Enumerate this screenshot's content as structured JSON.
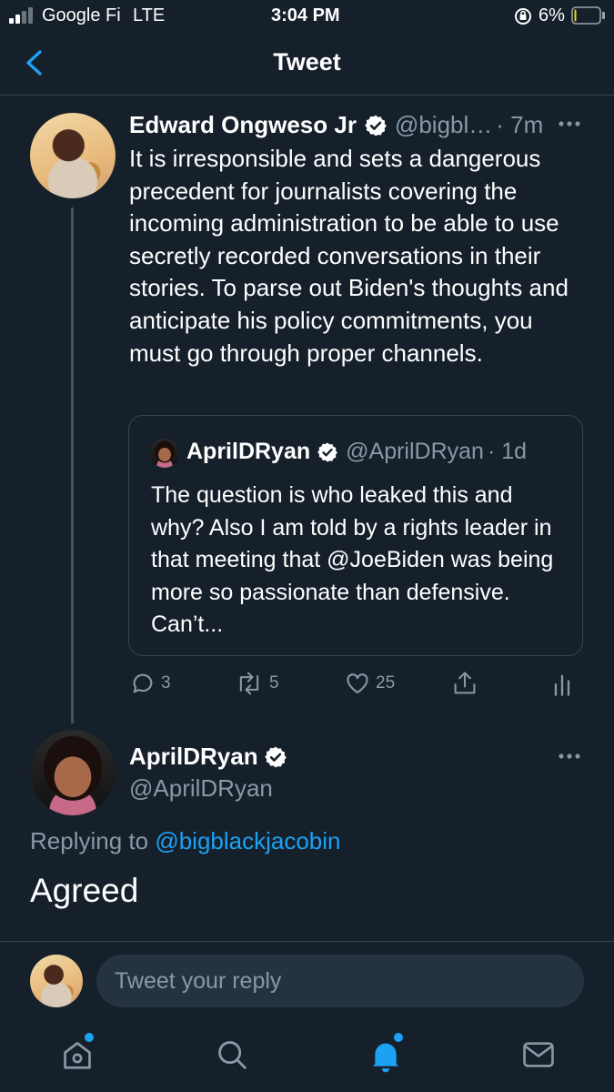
{
  "status_bar": {
    "carrier": "Google Fi",
    "network": "LTE",
    "time": "3:04 PM",
    "battery": "6%",
    "battery_level": 0.06
  },
  "header": {
    "title": "Tweet"
  },
  "main_tweet": {
    "author_name": "Edward Ongweso Jr",
    "handle": "@bigbl…",
    "time": "· 7m",
    "text": "It is irresponsible and sets a dangerous precedent for journalists covering the incoming administration to be able to use secretly recorded conversations in their stories. To parse out Biden's thoughts and anticipate his policy commitments, you must go through proper channels.",
    "quoted": {
      "author_name": "AprilDRyan",
      "handle": "@AprilDRyan",
      "time": "· 1d",
      "text": "The question is who leaked this and why? Also I am told by a rights leader in that meeting that @JoeBiden was being more so passionate than defensive.  Can’t..."
    },
    "actions": {
      "replies": "3",
      "retweets": "5",
      "likes": "25"
    }
  },
  "reply_tweet": {
    "author_name": "AprilDRyan",
    "handle": "@AprilDRyan",
    "replying_prefix": "Replying to",
    "replying_to": "@bigblackjacobin",
    "text": "Agreed"
  },
  "composer": {
    "placeholder": "Tweet your reply"
  },
  "tab_bar": {
    "items": [
      "home-icon",
      "search-icon",
      "notifications-icon",
      "messages-icon"
    ],
    "active": "notifications-icon"
  },
  "colors": {
    "background": "#15202b",
    "accent": "#1da1f2",
    "muted_text": "#8899a6",
    "border": "#38444d"
  }
}
